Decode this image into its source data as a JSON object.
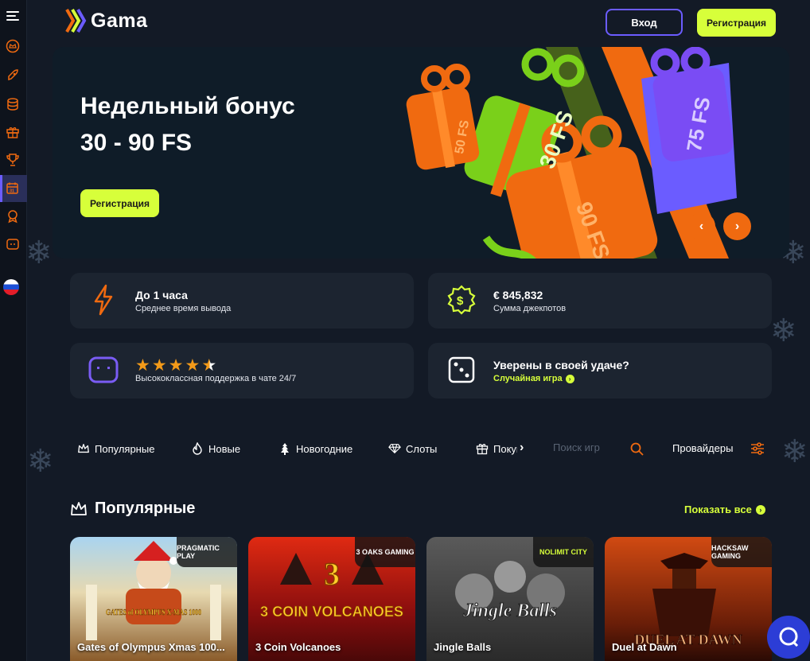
{
  "brand": {
    "name": "Gama"
  },
  "header": {
    "login_label": "Вход",
    "register_label": "Регистрация"
  },
  "banner": {
    "title_line1": "Недельный бонус",
    "title_line2": "30 - 90 FS",
    "cta_label": "Регистрация",
    "gift_labels": [
      "50 FS",
      "30 FS",
      "75 FS",
      "90 FS"
    ]
  },
  "info_cards": {
    "payout": {
      "title": "До 1 часа",
      "subtitle": "Среднее время вывода"
    },
    "jackpot": {
      "title": "€  845,832",
      "subtitle": "Сумма джекпотов"
    },
    "support": {
      "rating": 4.5,
      "subtitle": "Высококлассная поддержка в чате 24/7"
    },
    "random": {
      "title": "Уверены в своей удаче?",
      "link_label": "Случайная игра"
    }
  },
  "categories": {
    "tabs": [
      {
        "label": "Популярные",
        "icon": "crown-icon"
      },
      {
        "label": "Новые",
        "icon": "flame-icon"
      },
      {
        "label": "Новогодние",
        "icon": "tree-icon"
      },
      {
        "label": "Слоты",
        "icon": "diamond-icon"
      },
      {
        "label": "Покуп",
        "icon": "gift-icon"
      }
    ],
    "search_placeholder": "Поиск игр",
    "providers_label": "Провайдеры"
  },
  "popular": {
    "title": "Популярные",
    "show_all_label": "Показать все",
    "games": [
      {
        "name": "Gates of Olympus Xmas 100...",
        "provider": "PRAGMATIC PLAY",
        "art_title": "GATES of OLYMPUS X-MAS 1000"
      },
      {
        "name": "3 Coin Volcanoes",
        "provider": "3 OAKS GAMING",
        "art_title": "3 COIN VOLCANOES"
      },
      {
        "name": "Jingle Balls",
        "provider": "NOLIMIT CITY",
        "art_title": "Jingle Balls"
      },
      {
        "name": "Duel at Dawn",
        "provider": "HACKSAW GAMING",
        "art_title": "DUEL AT DAWN"
      }
    ]
  },
  "colors": {
    "accent_green": "#d7ff3a",
    "accent_purple": "#6b5cff",
    "accent_orange": "#f06a10",
    "background": "#131a26"
  }
}
